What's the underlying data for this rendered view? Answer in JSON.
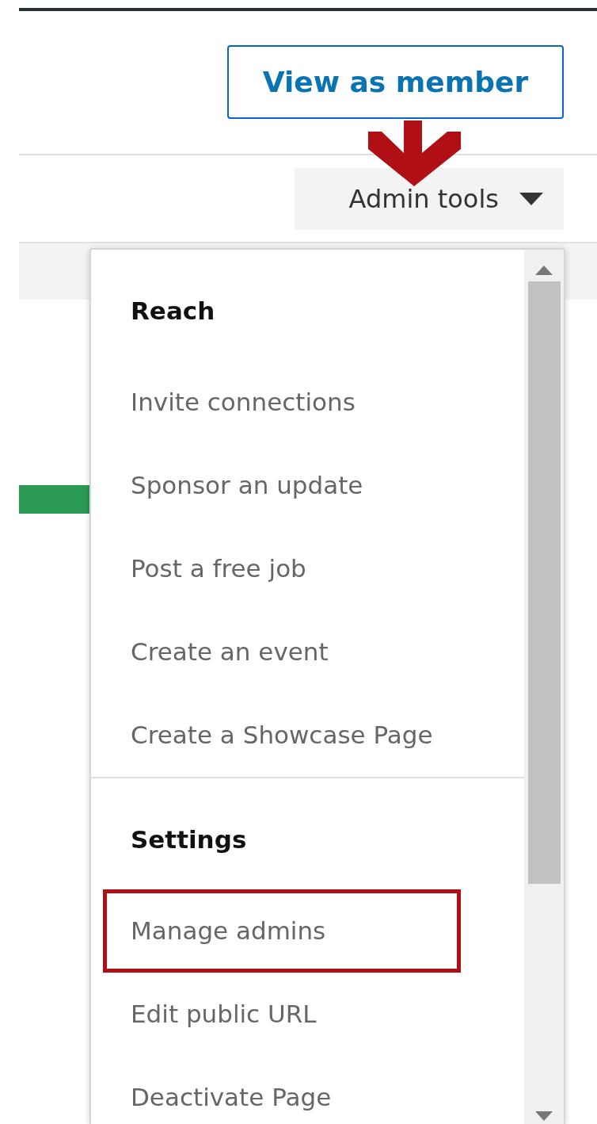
{
  "header": {
    "view_button": "View as member",
    "admin_button": "Admin tools"
  },
  "menu": {
    "sections": [
      {
        "heading": "Reach",
        "items": [
          {
            "label": "Invite connections",
            "highlighted": false
          },
          {
            "label": "Sponsor an update",
            "highlighted": false
          },
          {
            "label": "Post a free job",
            "highlighted": false
          },
          {
            "label": "Create an event",
            "highlighted": false
          },
          {
            "label": "Create a Showcase Page",
            "highlighted": false
          }
        ]
      },
      {
        "heading": "Settings",
        "items": [
          {
            "label": "Manage admins",
            "highlighted": true
          },
          {
            "label": "Edit public URL",
            "highlighted": false
          },
          {
            "label": "Deactivate Page",
            "highlighted": false
          }
        ]
      }
    ]
  }
}
